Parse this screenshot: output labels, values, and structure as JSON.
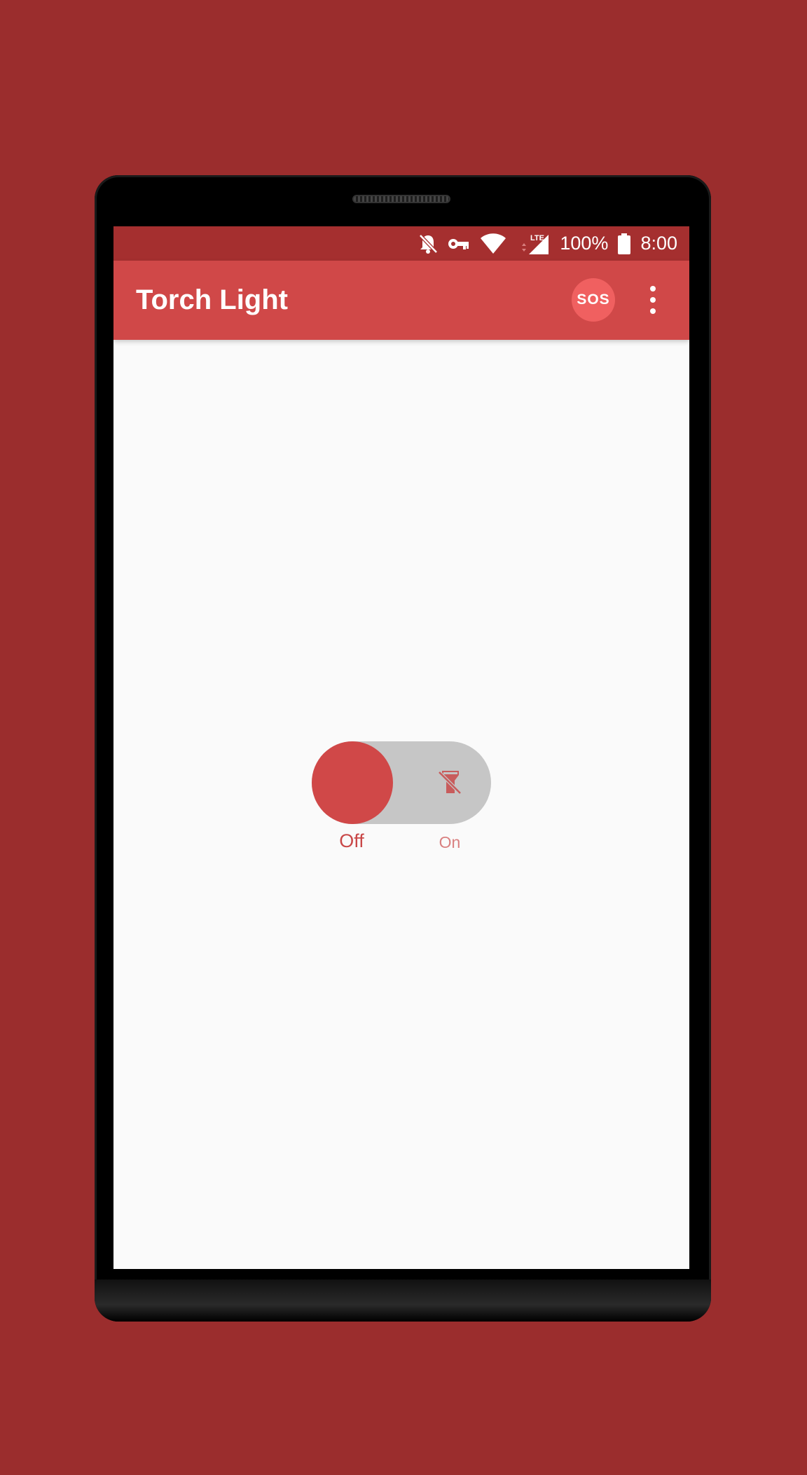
{
  "status_bar": {
    "icons": [
      "bell-off-icon",
      "vpn-key-icon",
      "wifi-icon",
      "lte-signal-icon",
      "battery-icon"
    ],
    "lte_label": "LTE",
    "battery_percent": "100%",
    "time": "8:00"
  },
  "app_bar": {
    "title": "Torch Light",
    "sos_label": "SOS",
    "more_icon": "more-vert-icon"
  },
  "torch_toggle": {
    "state": "off",
    "off_label": "Off",
    "on_label": "On",
    "icon": "flashlight-off-icon"
  },
  "colors": {
    "background": "#9b2d2d",
    "status_bar": "#a52f2f",
    "app_bar": "#d04848",
    "sos_button": "#f06060",
    "toggle_track": "#c6c6c6",
    "screen": "#fafafa"
  }
}
